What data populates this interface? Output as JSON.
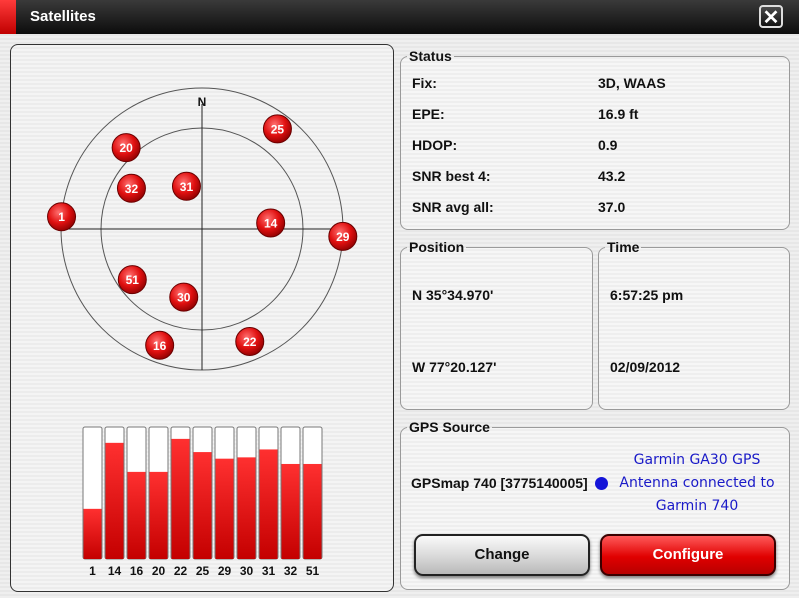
{
  "window": {
    "title": "Satellites",
    "close_label": "✕"
  },
  "sky": {
    "north_label": "N",
    "satellites": [
      {
        "id": "20",
        "az": 317,
        "el": 19
      },
      {
        "id": "25",
        "az": 37,
        "el": 10
      },
      {
        "id": "32",
        "az": 300,
        "el": 38
      },
      {
        "id": "31",
        "az": 340,
        "el": 61
      },
      {
        "id": "1",
        "az": 275,
        "el": 0
      },
      {
        "id": "14",
        "az": 85,
        "el": 46
      },
      {
        "id": "29",
        "az": 93,
        "el": 0
      },
      {
        "id": "51",
        "az": 234,
        "el": 35
      },
      {
        "id": "30",
        "az": 195,
        "el": 45
      },
      {
        "id": "16",
        "az": 200,
        "el": 11
      },
      {
        "id": "22",
        "az": 157,
        "el": 12
      }
    ]
  },
  "signal_bars": {
    "labels": [
      "1",
      "14",
      "16",
      "20",
      "22",
      "25",
      "29",
      "30",
      "31",
      "32",
      "51"
    ],
    "levels": [
      0.38,
      0.88,
      0.66,
      0.66,
      0.91,
      0.81,
      0.76,
      0.77,
      0.83,
      0.72,
      0.72
    ]
  },
  "status": {
    "legend": "Status",
    "rows": [
      {
        "label": "Fix:",
        "value": "3D, WAAS"
      },
      {
        "label": "EPE:",
        "value": "16.9 ft"
      },
      {
        "label": "HDOP:",
        "value": "0.9"
      },
      {
        "label": "SNR best 4:",
        "value": "43.2"
      },
      {
        "label": "SNR avg all:",
        "value": "37.0"
      }
    ]
  },
  "position": {
    "legend": "Position",
    "lat": "N  35°34.970'",
    "lon": "W  77°20.127'"
  },
  "time": {
    "legend": "Time",
    "time": "6:57:25 pm",
    "date": "02/09/2012"
  },
  "gps_source": {
    "legend": "GPS Source",
    "device": "GPSmap 740 [3775140005]",
    "desc_line1": "Garmin GA30 GPS",
    "desc_line2": "Antenna connected to",
    "desc_line3": "Garmin 740",
    "status_color": "#1414d8"
  },
  "buttons": {
    "change": "Change",
    "configure": "Configure"
  },
  "colors": {
    "accent_red": "#e00000",
    "title_bar": "#1a1a1a"
  }
}
